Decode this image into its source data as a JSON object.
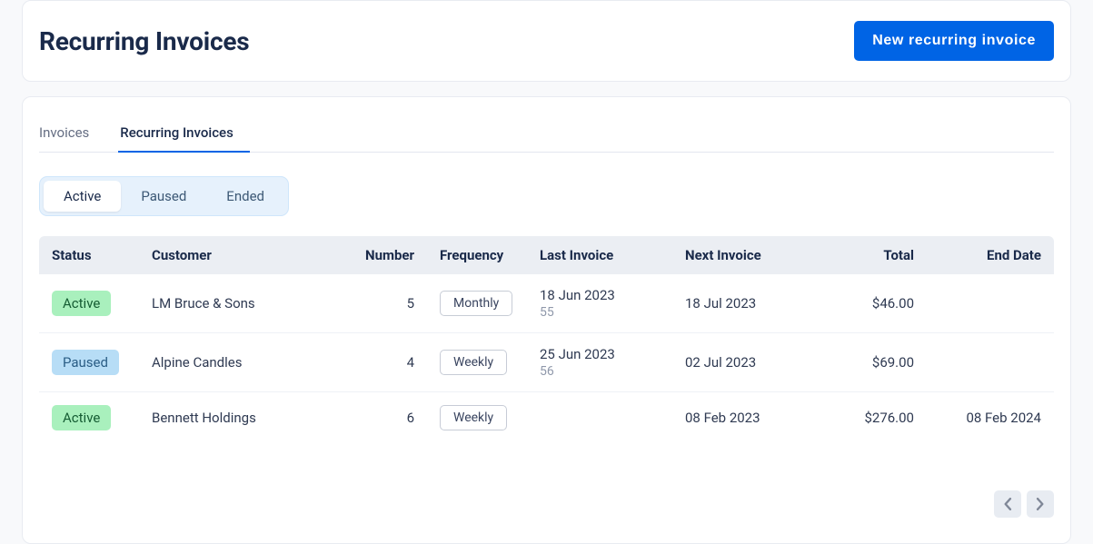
{
  "header": {
    "title": "Recurring Invoices",
    "new_button_label": "New recurring invoice"
  },
  "tabs": {
    "items": [
      {
        "label": "Invoices",
        "active": false
      },
      {
        "label": "Recurring Invoices",
        "active": true
      }
    ]
  },
  "filters": {
    "items": [
      {
        "label": "Active",
        "selected": true
      },
      {
        "label": "Paused",
        "selected": false
      },
      {
        "label": "Ended",
        "selected": false
      }
    ]
  },
  "columns": {
    "status": "Status",
    "customer": "Customer",
    "number": "Number",
    "frequency": "Frequency",
    "last_invoice": "Last Invoice",
    "next_invoice": "Next Invoice",
    "total": "Total",
    "end_date": "End Date"
  },
  "rows": [
    {
      "status": "Active",
      "customer": "LM Bruce & Sons",
      "number": "5",
      "frequency": "Monthly",
      "last_invoice_date": "18 Jun 2023",
      "last_invoice_number": "55",
      "next_invoice": "18 Jul 2023",
      "total": "$46.00",
      "end_date": ""
    },
    {
      "status": "Paused",
      "customer": "Alpine Candles",
      "number": "4",
      "frequency": "Weekly",
      "last_invoice_date": "25 Jun 2023",
      "last_invoice_number": "56",
      "next_invoice": "02 Jul 2023",
      "total": "$69.00",
      "end_date": ""
    },
    {
      "status": "Active",
      "customer": "Bennett Holdings",
      "number": "6",
      "frequency": "Weekly",
      "last_invoice_date": "",
      "last_invoice_number": "",
      "next_invoice": "08 Feb 2023",
      "total": "$276.00",
      "end_date": "08 Feb 2024"
    }
  ]
}
